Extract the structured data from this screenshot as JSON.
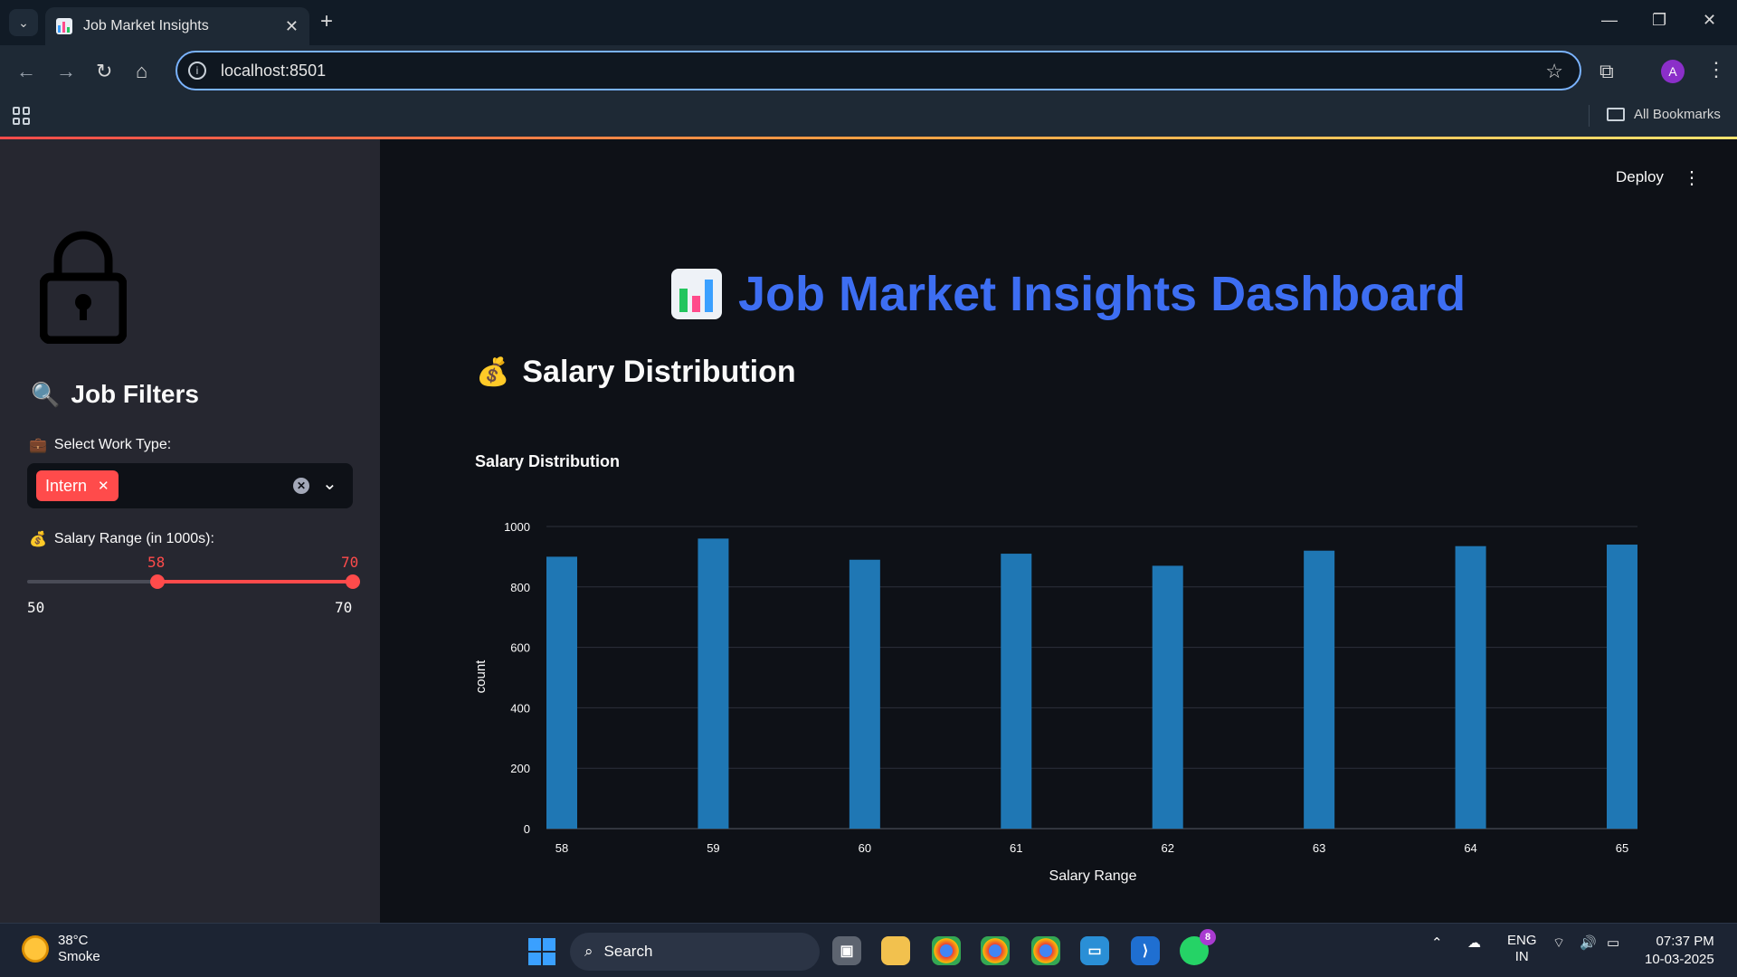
{
  "browser": {
    "tab_title": "Job Market Insights",
    "url": "localhost:8501",
    "bookmarks_label": "All Bookmarks",
    "avatar_letter": "A"
  },
  "app": {
    "deploy_label": "Deploy",
    "title": "Job Market Insights Dashboard",
    "section_title": "Salary Distribution",
    "chart_title": "Salary Distribution"
  },
  "sidebar": {
    "title": "Job Filters",
    "work_type_label": "Select Work Type:",
    "selected_work_type": "Intern",
    "salary_label": "Salary Range (in 1000s):",
    "slider": {
      "low": 58,
      "high": 70,
      "min": 50,
      "max": 70
    }
  },
  "chart_data": {
    "type": "bar",
    "title": "Salary Distribution",
    "xlabel": "Salary Range",
    "ylabel": "count",
    "categories": [
      "58",
      "59",
      "60",
      "61",
      "62",
      "63",
      "64",
      "65"
    ],
    "values": [
      900,
      960,
      890,
      910,
      870,
      920,
      935,
      940
    ],
    "ylim": [
      0,
      1000
    ],
    "yticks": [
      0,
      200,
      400,
      600,
      800,
      1000
    ],
    "bar_color": "#1f77b4",
    "grid": true
  },
  "taskbar": {
    "temperature": "38°C",
    "weather": "Smoke",
    "search_label": "Search",
    "language_line1": "ENG",
    "language_line2": "IN",
    "time": "07:37 PM",
    "date": "10-03-2025",
    "whatsapp_badge": "8"
  },
  "colors": {
    "accent": "#ff4b4b",
    "title_blue": "#3d6ef2",
    "sidebar_bg": "#262730",
    "main_bg": "#0e1117"
  }
}
